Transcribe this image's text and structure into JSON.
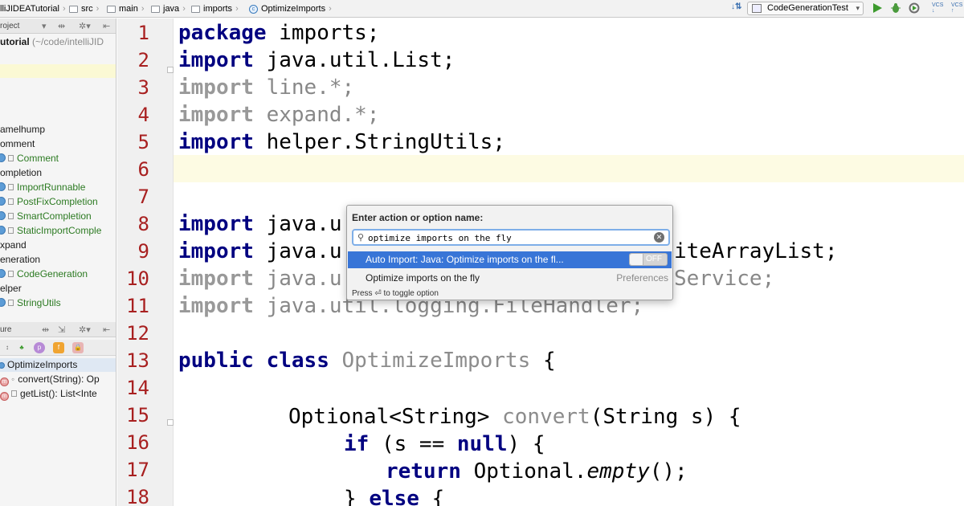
{
  "breadcrumbs": [
    {
      "label": "lliJIDEATutorial",
      "icon": "folder-icon"
    },
    {
      "label": "src",
      "icon": "folder-icon"
    },
    {
      "label": "main",
      "icon": "folder-icon"
    },
    {
      "label": "java",
      "icon": "folder-icon"
    },
    {
      "label": "imports",
      "icon": "folder-icon"
    },
    {
      "label": "OptimizeImports",
      "icon": "class-icon"
    }
  ],
  "toolbar": {
    "run_config": "CodeGenerationTest",
    "vcs_label": "VCS"
  },
  "project_panel": {
    "header": "roject",
    "root_name": "utorial",
    "root_path": "(~/code/intelliJID",
    "tree": [
      {
        "label": "amelhump",
        "type": "package"
      },
      {
        "label": "omment",
        "type": "package"
      },
      {
        "label": "Comment",
        "type": "class"
      },
      {
        "label": "ompletion",
        "type": "package"
      },
      {
        "label": "ImportRunnable",
        "type": "class"
      },
      {
        "label": "PostFixCompletion",
        "type": "class"
      },
      {
        "label": "SmartCompletion",
        "type": "class"
      },
      {
        "label": "StaticImportComple",
        "type": "class"
      },
      {
        "label": "xpand",
        "type": "package"
      },
      {
        "label": "eneration",
        "type": "package"
      },
      {
        "label": "CodeGeneration",
        "type": "class"
      },
      {
        "label": "elper",
        "type": "package"
      },
      {
        "label": "StringUtils",
        "type": "class"
      }
    ]
  },
  "structure_panel": {
    "header": "ure",
    "class_name": "OptimizeImports",
    "members": [
      {
        "label": "convert(String): Op",
        "icon": "m"
      },
      {
        "label": "getList(): List<Inte",
        "icon": "m"
      }
    ]
  },
  "editor": {
    "line_numbers": [
      "1",
      "2",
      "3",
      "4",
      "5",
      "6",
      "7",
      "8",
      "9",
      "10",
      "11",
      "12",
      "13",
      "14",
      "15",
      "16",
      "17",
      "18"
    ],
    "lines": {
      "l1_kw": "package",
      "l1_rest": " imports;",
      "l2_kw": "import",
      "l2_rest": " java.util.List;",
      "l3_kw": "import",
      "l3_rest": " line.*;",
      "l4_kw": "import",
      "l4_rest": " expand.*;",
      "l5_kw": "import",
      "l5_rest": " helper.StringUtils;",
      "l8_kw": "import",
      "l8_rest": " java.u",
      "l9_kw": "import",
      "l9_rest": " java.u",
      "l9_tail": "iteArrayList;",
      "l10_kw": "import",
      "l10_rest": " java.u",
      "l10_tail": "Service;",
      "l11_kw": "import",
      "l11_rest": " java.util.logging.FileHandler;",
      "l13_kw1": "public",
      "l13_kw2": " class",
      "l13_name": " OptimizeImports",
      "l13_brace": " {",
      "l15_pre": "Optional<String> ",
      "l15_name": "convert",
      "l15_post": "(String s) {",
      "l16_kw": "if",
      "l16_mid": " (s == ",
      "l16_null": "null",
      "l16_post": ") {",
      "l17_kw": "return",
      "l17_mid": " Optional.",
      "l17_it": "empty",
      "l17_post": "();",
      "l18_pre": "} ",
      "l18_kw": "else",
      "l18_post": " {"
    }
  },
  "popup": {
    "title": "Enter action or option name:",
    "search_value": "optimize imports on the fly",
    "results": [
      {
        "label": "Auto Import: Java: Optimize imports on the fl...",
        "toggle": "OFF",
        "selected": true
      },
      {
        "label": "Optimize imports on the fly",
        "category": "Preferences",
        "selected": false
      }
    ],
    "hint": "Press ⏎ to toggle option"
  },
  "colors": {
    "keyword": "#000080",
    "line_number": "#a82020",
    "selection": "#3875d7",
    "unused_import": "#888888",
    "current_line": "#fdfbe3"
  }
}
